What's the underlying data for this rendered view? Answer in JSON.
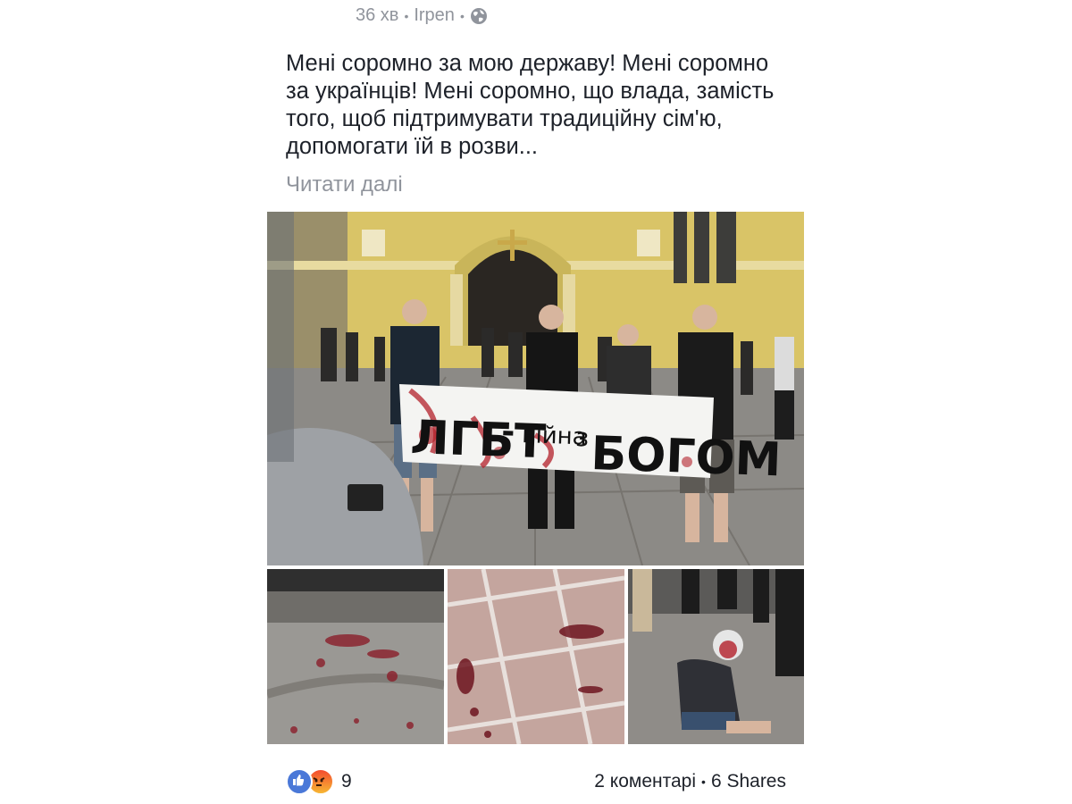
{
  "post": {
    "time": "36 хв",
    "location": "Irpen",
    "privacy_icon": "globe-icon",
    "text": "Мені соромно за мою державу! Мені соромно за українців! Мені соромно, що влада, замість того, щоб підтримувати традиційну сім'ю, допомогати їй в розви...",
    "read_more": "Читати далі"
  },
  "photos": {
    "banner_text": {
      "part1": "ЛГБТ",
      "dash": "-",
      "part2": "війна",
      "part3": "з",
      "part4": "БОГОМ"
    }
  },
  "footer": {
    "reaction_icons": [
      "like-icon",
      "angry-icon"
    ],
    "reaction_count": "9",
    "comments": "2 коментарі",
    "shares": "6 Shares"
  }
}
